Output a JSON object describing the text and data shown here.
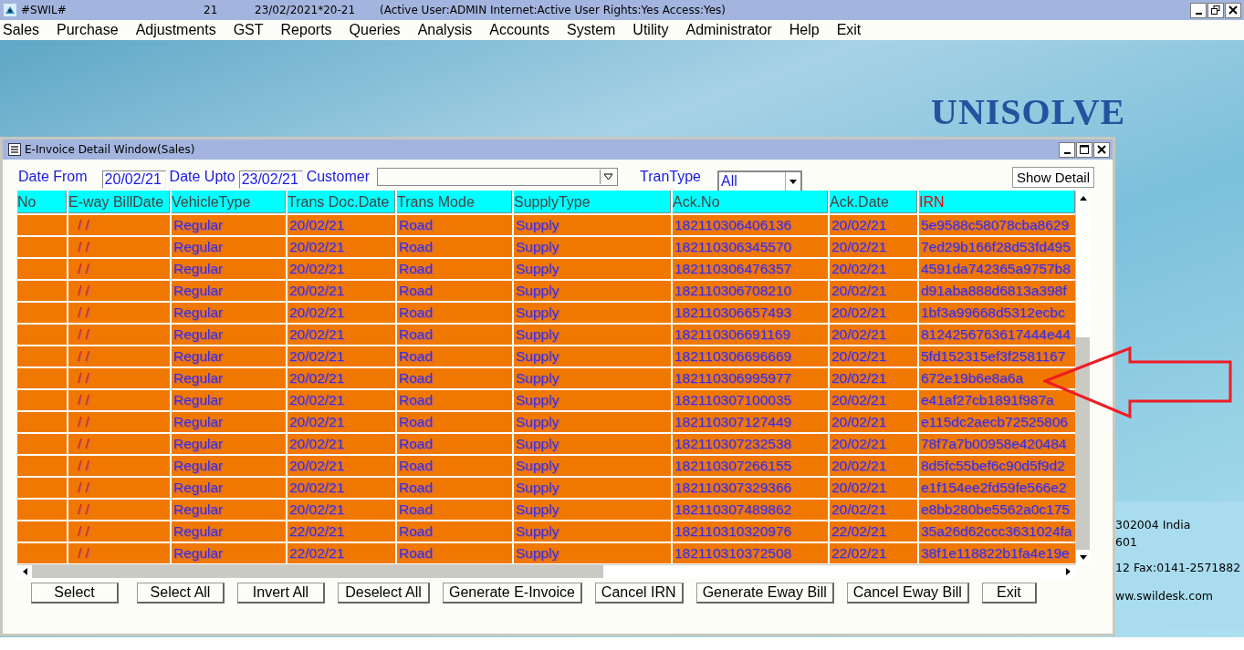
{
  "window": {
    "title": "#SWIL#",
    "number": "21",
    "date": "23/02/2021*20-21",
    "status": "(Active User:ADMIN Internet:Active  User Rights:Yes Access:Yes)"
  },
  "menu": [
    "Sales",
    "Purchase",
    "Adjustments",
    "GST",
    "Reports",
    "Queries",
    "Analysis",
    "Accounts",
    "System",
    "Utility",
    "Administrator",
    "Help",
    "Exit"
  ],
  "background": {
    "logo": "UNISOLVE",
    "address_lines": [
      "302004 India",
      "601",
      "12 Fax:0141-2571882",
      "ww.swildesk.com"
    ]
  },
  "dialog": {
    "title": "E-Invoice Detail Window(Sales)",
    "filters": {
      "date_from_label": "Date From",
      "date_from": "20/02/21",
      "date_upto_label": "Date Upto",
      "date_upto": "23/02/21",
      "customer_label": "Customer",
      "trantype_label": "TranType",
      "trantype": "All",
      "show_button": "Show Detail"
    },
    "columns": [
      {
        "label": "No",
        "sorted": false
      },
      {
        "label": "E-way BillDate",
        "sorted": false
      },
      {
        "label": "VehicleType",
        "sorted": false
      },
      {
        "label": "Trans Doc.Date",
        "sorted": false
      },
      {
        "label": "Trans Mode",
        "sorted": false
      },
      {
        "label": "SupplyType",
        "sorted": false
      },
      {
        "label": "Ack.No",
        "sorted": false
      },
      {
        "label": "Ack.Date",
        "sorted": false
      },
      {
        "label": "IRN",
        "sorted": true
      }
    ],
    "rows": [
      [
        "",
        "/ /",
        "Regular",
        "20/02/21",
        "Road",
        "Supply",
        "182110306406136",
        "20/02/21",
        "5e9588c58078cba8629"
      ],
      [
        "",
        "/ /",
        "Regular",
        "20/02/21",
        "Road",
        "Supply",
        "182110306345570",
        "20/02/21",
        "7ed29b166f28d53fd495"
      ],
      [
        "",
        "/ /",
        "Regular",
        "20/02/21",
        "Road",
        "Supply",
        "182110306476357",
        "20/02/21",
        "4591da742365a9757b8"
      ],
      [
        "",
        "/ /",
        "Regular",
        "20/02/21",
        "Road",
        "Supply",
        "182110306708210",
        "20/02/21",
        "d91aba888d6813a398f"
      ],
      [
        "",
        "/ /",
        "Regular",
        "20/02/21",
        "Road",
        "Supply",
        "182110306657493",
        "20/02/21",
        "1bf3a99668d5312ecbc"
      ],
      [
        "",
        "/ /",
        "Regular",
        "20/02/21",
        "Road",
        "Supply",
        "182110306691169",
        "20/02/21",
        "8124256763617444e44"
      ],
      [
        "",
        "/ /",
        "Regular",
        "20/02/21",
        "Road",
        "Supply",
        "182110306696669",
        "20/02/21",
        "5fd152315ef3f2581167"
      ],
      [
        "",
        "/ /",
        "Regular",
        "20/02/21",
        "Road",
        "Supply",
        "182110306995977",
        "20/02/21",
        "672e19b6e8a6a"
      ],
      [
        "",
        "/ /",
        "Regular",
        "20/02/21",
        "Road",
        "Supply",
        "182110307100035",
        "20/02/21",
        "e41af27cb1891f987a"
      ],
      [
        "",
        "/ /",
        "Regular",
        "20/02/21",
        "Road",
        "Supply",
        "182110307127449",
        "20/02/21",
        "e115dc2aecb72525806"
      ],
      [
        "",
        "/ /",
        "Regular",
        "20/02/21",
        "Road",
        "Supply",
        "182110307232538",
        "20/02/21",
        "78f7a7b00958e420484"
      ],
      [
        "",
        "/ /",
        "Regular",
        "20/02/21",
        "Road",
        "Supply",
        "182110307266155",
        "20/02/21",
        "8d5fc55bef6c90d5f9d2"
      ],
      [
        "",
        "/ /",
        "Regular",
        "20/02/21",
        "Road",
        "Supply",
        "182110307329366",
        "20/02/21",
        "e1f154ee2fd59fe566e2"
      ],
      [
        "",
        "/ /",
        "Regular",
        "20/02/21",
        "Road",
        "Supply",
        "182110307489862",
        "20/02/21",
        "e8bb280be5562a0c175"
      ],
      [
        "",
        "/ /",
        "Regular",
        "22/02/21",
        "Road",
        "Supply",
        "182110310320976",
        "22/02/21",
        "35a26d62ccc3631024fa"
      ],
      [
        "",
        "/ /",
        "Regular",
        "22/02/21",
        "Road",
        "Supply",
        "182110310372508",
        "22/02/21",
        "38f1e118822b1fa4e19e"
      ]
    ],
    "buttons": [
      "Select",
      "Select All",
      "Invert All",
      "Deselect All",
      "Generate E-Invoice",
      "Cancel IRN",
      "Generate Eway Bill",
      "Cancel Eway Bill",
      "Exit"
    ]
  }
}
